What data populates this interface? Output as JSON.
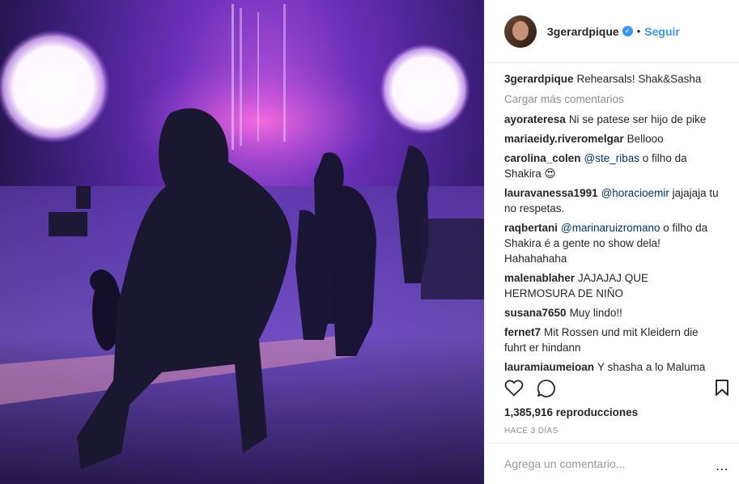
{
  "header": {
    "username": "3gerardpique",
    "separator": "•",
    "follow_label": "Seguir"
  },
  "caption": {
    "username": "3gerardpique",
    "text": "Rehearsals! Shak&Sasha"
  },
  "load_more_label": "Cargar más comentarios",
  "comments": [
    {
      "user": "ayorateresa",
      "mention": "",
      "text": "Ni se patese ser hijo de pike"
    },
    {
      "user": "mariaeidy.riveromelgar",
      "mention": "",
      "text": "Bellooo"
    },
    {
      "user": "carolina_colen",
      "mention": "@ste_ribas",
      "text": "o filho da Shakira 😍"
    },
    {
      "user": "lauravanessa1991",
      "mention": "@horacioemir",
      "text": "jajajaja tu no respetas."
    },
    {
      "user": "raqbertani",
      "mention": "@marinaruizromano",
      "text": "o filho da Shakira é a gente no show dela! Hahahahaha"
    },
    {
      "user": "malenablaher",
      "mention": "",
      "text": "JAJAJAJ QUE HERMOSURA DE NIÑO"
    },
    {
      "user": "susana7650",
      "mention": "",
      "text": "Muy lindo!!"
    },
    {
      "user": "fernet7",
      "mention": "",
      "text": "Mit Rossen und mit Kleidern die fuhrt er hindann"
    },
    {
      "user": "lauramiaumeioan",
      "mention": "",
      "text": "Y shasha a lo Maluma"
    }
  ],
  "stats": {
    "views": "1,385,916 reproducciones",
    "time": "HACE 3 DÍAS"
  },
  "add_comment_placeholder": "Agrega un comentario...",
  "more_icon": "⋯",
  "colors": {
    "link": "#3897f0",
    "mention": "#003569",
    "muted": "#8e8e8e"
  }
}
